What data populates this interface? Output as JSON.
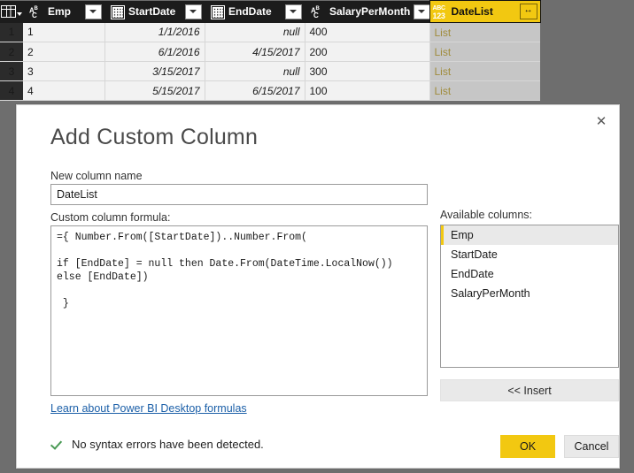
{
  "grid": {
    "columns": [
      {
        "label": "Emp",
        "type_icon": "abc-text-icon",
        "has_dropdown": true,
        "align": "left"
      },
      {
        "label": "StartDate",
        "type_icon": "calendar-icon",
        "has_dropdown": true,
        "align": "right"
      },
      {
        "label": "EndDate",
        "type_icon": "calendar-icon",
        "has_dropdown": true,
        "align": "right"
      },
      {
        "label": "SalaryPerMonth",
        "type_icon": "abc-text-icon",
        "has_dropdown": true,
        "align": "left"
      },
      {
        "label": "DateList",
        "type_icon": "abc-123-icon",
        "has_dropdown": false,
        "align": "left"
      }
    ],
    "expand_icon_glyph": "↔",
    "rows": [
      {
        "num": "1",
        "Emp": "1",
        "StartDate": "1/1/2016",
        "EndDate": "null",
        "SalaryPerMonth": "400",
        "DateList": "List"
      },
      {
        "num": "2",
        "Emp": "2",
        "StartDate": "6/1/2016",
        "EndDate": "4/15/2017",
        "SalaryPerMonth": "200",
        "DateList": "List"
      },
      {
        "num": "3",
        "Emp": "3",
        "StartDate": "3/15/2017",
        "EndDate": "null",
        "SalaryPerMonth": "300",
        "DateList": "List"
      },
      {
        "num": "4",
        "Emp": "4",
        "StartDate": "5/15/2017",
        "EndDate": "6/15/2017",
        "SalaryPerMonth": "100",
        "DateList": "List"
      }
    ],
    "highlight_color": "#f2c811",
    "header_bg": "#1c1c1c",
    "selected_cell_bg": "#c6c6c6"
  },
  "dialog": {
    "title": "Add Custom Column",
    "close_glyph": "✕",
    "column_name": {
      "label": "New column name",
      "value": "DateList",
      "placeholder": "New column name"
    },
    "formula": {
      "label": "Custom column formula:",
      "value": "={ Number.From([StartDate])..Number.From(\n\nif [EndDate] = null then Date.From(DateTime.LocalNow()) else [EndDate])\n\n }",
      "placeholder": ""
    },
    "learn_link": "Learn about Power BI Desktop formulas",
    "available_columns": {
      "label": "Available columns:",
      "items": [
        {
          "label": "Emp",
          "selected": true
        },
        {
          "label": "StartDate",
          "selected": false
        },
        {
          "label": "EndDate",
          "selected": false
        },
        {
          "label": "SalaryPerMonth",
          "selected": false
        }
      ]
    },
    "insert_button": "<< Insert",
    "status": {
      "icon": "check-icon",
      "text": "No syntax errors have been detected.",
      "color": "#4a9a55"
    },
    "ok_button": "OK",
    "cancel_button": "Cancel",
    "accent_color": "#f2c811"
  }
}
